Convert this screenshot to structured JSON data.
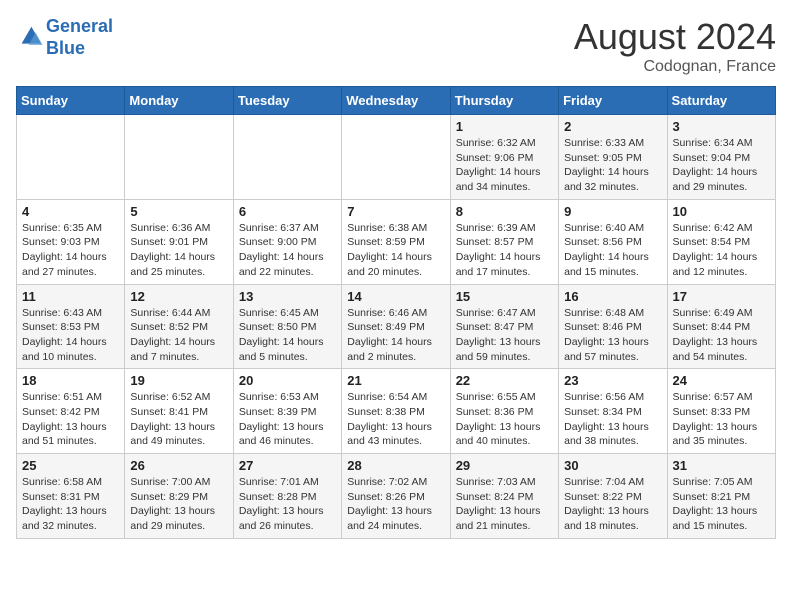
{
  "header": {
    "logo_line1": "General",
    "logo_line2": "Blue",
    "month": "August 2024",
    "location": "Codognan, France"
  },
  "days_of_week": [
    "Sunday",
    "Monday",
    "Tuesday",
    "Wednesday",
    "Thursday",
    "Friday",
    "Saturday"
  ],
  "weeks": [
    [
      {
        "day": "",
        "detail": ""
      },
      {
        "day": "",
        "detail": ""
      },
      {
        "day": "",
        "detail": ""
      },
      {
        "day": "",
        "detail": ""
      },
      {
        "day": "1",
        "detail": "Sunrise: 6:32 AM\nSunset: 9:06 PM\nDaylight: 14 hours\nand 34 minutes."
      },
      {
        "day": "2",
        "detail": "Sunrise: 6:33 AM\nSunset: 9:05 PM\nDaylight: 14 hours\nand 32 minutes."
      },
      {
        "day": "3",
        "detail": "Sunrise: 6:34 AM\nSunset: 9:04 PM\nDaylight: 14 hours\nand 29 minutes."
      }
    ],
    [
      {
        "day": "4",
        "detail": "Sunrise: 6:35 AM\nSunset: 9:03 PM\nDaylight: 14 hours\nand 27 minutes."
      },
      {
        "day": "5",
        "detail": "Sunrise: 6:36 AM\nSunset: 9:01 PM\nDaylight: 14 hours\nand 25 minutes."
      },
      {
        "day": "6",
        "detail": "Sunrise: 6:37 AM\nSunset: 9:00 PM\nDaylight: 14 hours\nand 22 minutes."
      },
      {
        "day": "7",
        "detail": "Sunrise: 6:38 AM\nSunset: 8:59 PM\nDaylight: 14 hours\nand 20 minutes."
      },
      {
        "day": "8",
        "detail": "Sunrise: 6:39 AM\nSunset: 8:57 PM\nDaylight: 14 hours\nand 17 minutes."
      },
      {
        "day": "9",
        "detail": "Sunrise: 6:40 AM\nSunset: 8:56 PM\nDaylight: 14 hours\nand 15 minutes."
      },
      {
        "day": "10",
        "detail": "Sunrise: 6:42 AM\nSunset: 8:54 PM\nDaylight: 14 hours\nand 12 minutes."
      }
    ],
    [
      {
        "day": "11",
        "detail": "Sunrise: 6:43 AM\nSunset: 8:53 PM\nDaylight: 14 hours\nand 10 minutes."
      },
      {
        "day": "12",
        "detail": "Sunrise: 6:44 AM\nSunset: 8:52 PM\nDaylight: 14 hours\nand 7 minutes."
      },
      {
        "day": "13",
        "detail": "Sunrise: 6:45 AM\nSunset: 8:50 PM\nDaylight: 14 hours\nand 5 minutes."
      },
      {
        "day": "14",
        "detail": "Sunrise: 6:46 AM\nSunset: 8:49 PM\nDaylight: 14 hours\nand 2 minutes."
      },
      {
        "day": "15",
        "detail": "Sunrise: 6:47 AM\nSunset: 8:47 PM\nDaylight: 13 hours\nand 59 minutes."
      },
      {
        "day": "16",
        "detail": "Sunrise: 6:48 AM\nSunset: 8:46 PM\nDaylight: 13 hours\nand 57 minutes."
      },
      {
        "day": "17",
        "detail": "Sunrise: 6:49 AM\nSunset: 8:44 PM\nDaylight: 13 hours\nand 54 minutes."
      }
    ],
    [
      {
        "day": "18",
        "detail": "Sunrise: 6:51 AM\nSunset: 8:42 PM\nDaylight: 13 hours\nand 51 minutes."
      },
      {
        "day": "19",
        "detail": "Sunrise: 6:52 AM\nSunset: 8:41 PM\nDaylight: 13 hours\nand 49 minutes."
      },
      {
        "day": "20",
        "detail": "Sunrise: 6:53 AM\nSunset: 8:39 PM\nDaylight: 13 hours\nand 46 minutes."
      },
      {
        "day": "21",
        "detail": "Sunrise: 6:54 AM\nSunset: 8:38 PM\nDaylight: 13 hours\nand 43 minutes."
      },
      {
        "day": "22",
        "detail": "Sunrise: 6:55 AM\nSunset: 8:36 PM\nDaylight: 13 hours\nand 40 minutes."
      },
      {
        "day": "23",
        "detail": "Sunrise: 6:56 AM\nSunset: 8:34 PM\nDaylight: 13 hours\nand 38 minutes."
      },
      {
        "day": "24",
        "detail": "Sunrise: 6:57 AM\nSunset: 8:33 PM\nDaylight: 13 hours\nand 35 minutes."
      }
    ],
    [
      {
        "day": "25",
        "detail": "Sunrise: 6:58 AM\nSunset: 8:31 PM\nDaylight: 13 hours\nand 32 minutes."
      },
      {
        "day": "26",
        "detail": "Sunrise: 7:00 AM\nSunset: 8:29 PM\nDaylight: 13 hours\nand 29 minutes."
      },
      {
        "day": "27",
        "detail": "Sunrise: 7:01 AM\nSunset: 8:28 PM\nDaylight: 13 hours\nand 26 minutes."
      },
      {
        "day": "28",
        "detail": "Sunrise: 7:02 AM\nSunset: 8:26 PM\nDaylight: 13 hours\nand 24 minutes."
      },
      {
        "day": "29",
        "detail": "Sunrise: 7:03 AM\nSunset: 8:24 PM\nDaylight: 13 hours\nand 21 minutes."
      },
      {
        "day": "30",
        "detail": "Sunrise: 7:04 AM\nSunset: 8:22 PM\nDaylight: 13 hours\nand 18 minutes."
      },
      {
        "day": "31",
        "detail": "Sunrise: 7:05 AM\nSunset: 8:21 PM\nDaylight: 13 hours\nand 15 minutes."
      }
    ]
  ]
}
